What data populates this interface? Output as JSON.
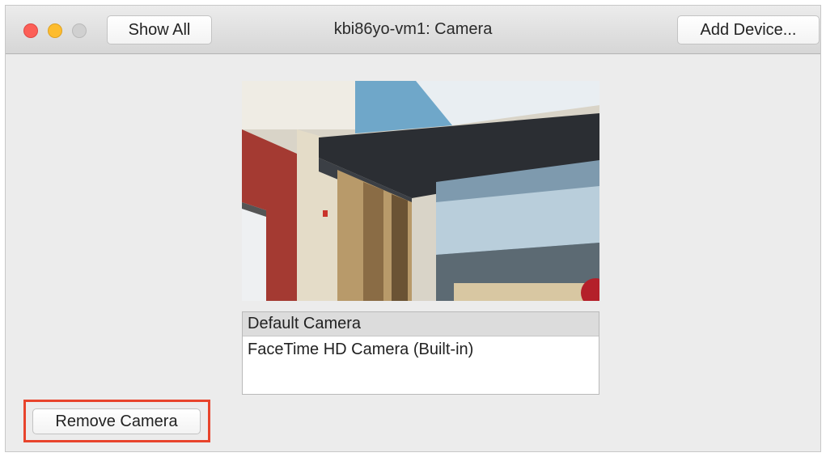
{
  "window": {
    "title": "kbi86yo-vm1: Camera",
    "show_all_label": "Show All",
    "add_device_label": "Add Device..."
  },
  "camera_preview": {
    "description": "live-camera-feed"
  },
  "device_list": {
    "header": "Default Camera",
    "items": [
      "FaceTime HD Camera (Built-in)"
    ]
  },
  "actions": {
    "remove_camera_label": "Remove Camera"
  },
  "colors": {
    "highlight_border": "#e8442c",
    "close": "#fc5f57",
    "minimize": "#fdbc2e",
    "zoom_disabled": "#d0d0d0"
  },
  "icons": [
    "close-icon",
    "minimize-icon",
    "zoom-icon"
  ]
}
